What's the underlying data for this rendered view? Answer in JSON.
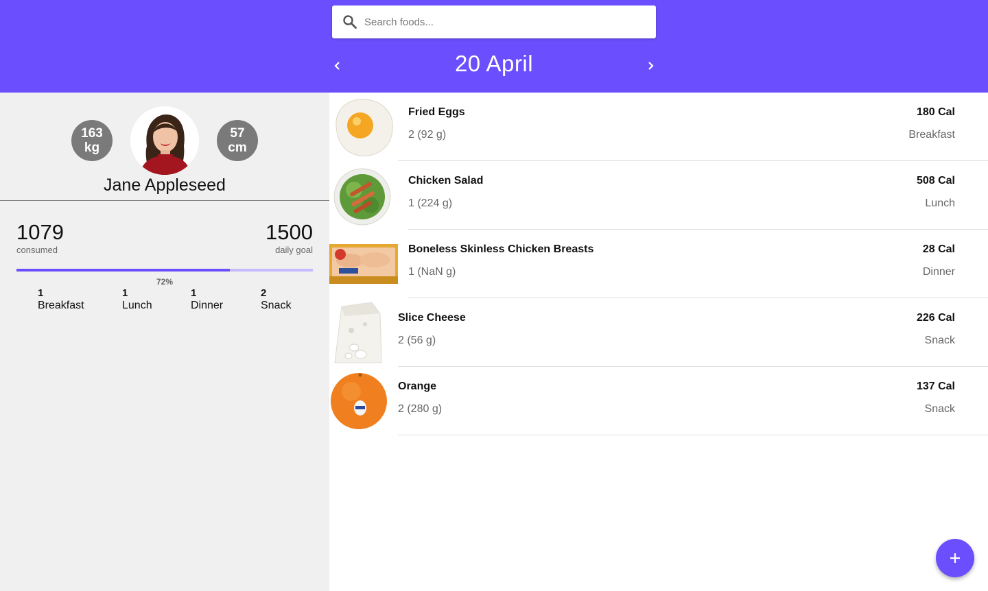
{
  "header": {
    "search_placeholder": "Search foods...",
    "date_title": "20 April",
    "accent_color": "#6b4ffe"
  },
  "profile": {
    "weight_value": "163",
    "weight_unit": "kg",
    "height_value": "57",
    "height_unit": "cm",
    "name": "Jane Appleseed"
  },
  "summary": {
    "consumed": "1079",
    "consumed_label": "consumed",
    "goal": "1500",
    "goal_label": "daily goal",
    "percent_label": "72%",
    "progress_fraction": 0.72
  },
  "meal_counts": [
    {
      "count": "1",
      "label": "Breakfast"
    },
    {
      "count": "1",
      "label": "Lunch"
    },
    {
      "count": "1",
      "label": "Dinner"
    },
    {
      "count": "2",
      "label": "Snack"
    }
  ],
  "foods": [
    {
      "name": "Fried Eggs",
      "quantity": "2 (92 g)",
      "calories": "180 Cal",
      "meal": "Breakfast",
      "image_icon": "fried-egg-image"
    },
    {
      "name": "Chicken Salad",
      "quantity": "1 (224 g)",
      "calories": "508 Cal",
      "meal": "Lunch",
      "image_icon": "salad-image"
    },
    {
      "name": "Boneless Skinless Chicken Breasts",
      "quantity": "1 (NaN g)",
      "calories": "28 Cal",
      "meal": "Dinner",
      "image_icon": "chicken-pack-image"
    },
    {
      "name": "Slice Cheese",
      "quantity": "2 (56 g)",
      "calories": "226 Cal",
      "meal": "Snack",
      "image_icon": "cheese-image"
    },
    {
      "name": "Orange",
      "quantity": "2 (280 g)",
      "calories": "137 Cal",
      "meal": "Snack",
      "image_icon": "orange-image"
    }
  ],
  "fab": {
    "icon": "plus-icon"
  }
}
